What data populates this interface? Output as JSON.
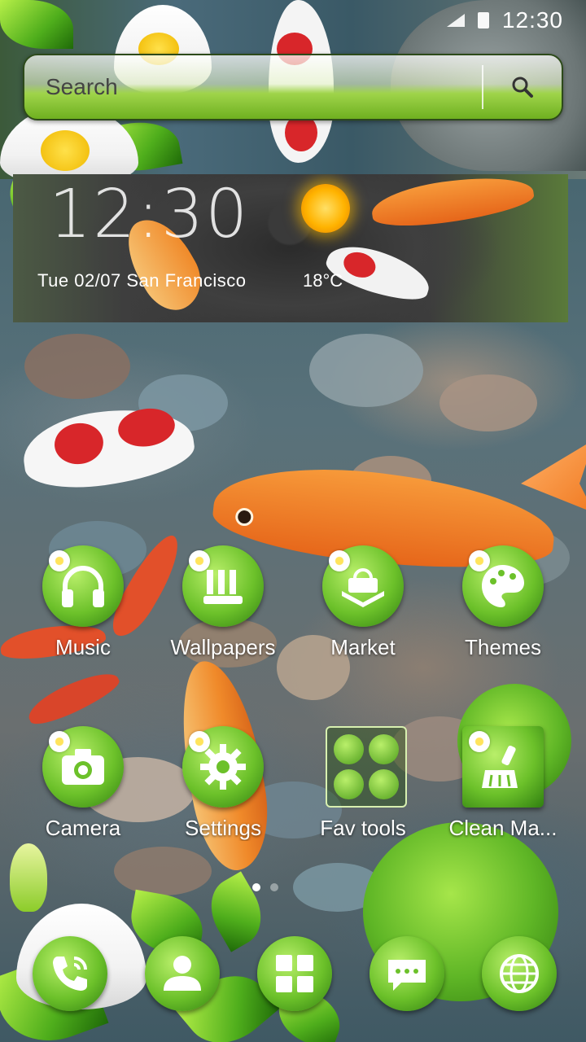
{
  "status_bar": {
    "time": "12:30"
  },
  "search": {
    "placeholder": "Search"
  },
  "weather": {
    "clock": "12:30",
    "date_line": "Tue  02/07  San Francisco",
    "temperature": "18°C",
    "condition_icon": "sun-icon"
  },
  "apps": [
    {
      "label": "Music",
      "icon": "headphones-icon"
    },
    {
      "label": "Wallpapers",
      "icon": "wallpapers-icon"
    },
    {
      "label": "Market",
      "icon": "shopping-bag-icon"
    },
    {
      "label": "Themes",
      "icon": "palette-icon"
    },
    {
      "label": "Camera",
      "icon": "camera-icon"
    },
    {
      "label": "Settings",
      "icon": "gear-icon"
    },
    {
      "label": "Fav tools",
      "icon": "folder-icon"
    },
    {
      "label": "Clean Ma...",
      "icon": "broom-icon"
    }
  ],
  "page_indicator": {
    "pages": 2,
    "current": 1
  },
  "dock": [
    {
      "icon": "phone-icon"
    },
    {
      "icon": "contacts-icon"
    },
    {
      "icon": "app-drawer-icon"
    },
    {
      "icon": "messages-icon"
    },
    {
      "icon": "browser-globe-icon"
    }
  ],
  "colors": {
    "leaf_green": "#6cc12a",
    "dark_green": "#2f7e10",
    "koi_orange": "#f07a22",
    "koi_red": "#d8262a"
  }
}
